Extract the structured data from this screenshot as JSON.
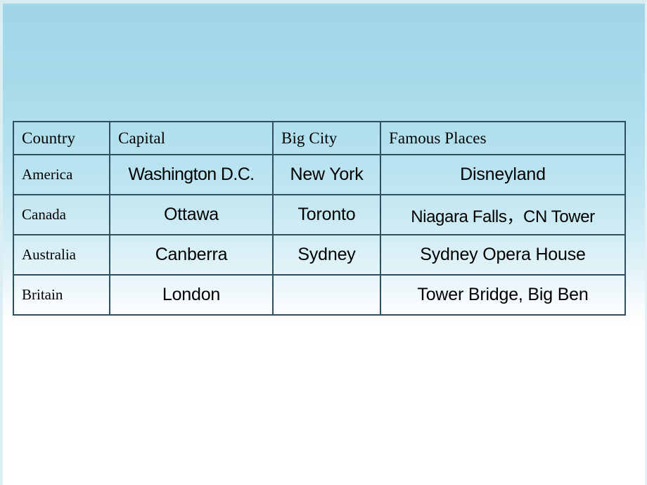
{
  "slide": {
    "background_top_color": "#a4d9e8",
    "background_bottom_color": "#ffffff",
    "table_border_color": "#2d4f5e",
    "text_color": "#000000"
  },
  "table": {
    "headers": [
      "Country",
      "Capital",
      "Big City",
      "Famous Places"
    ],
    "rows": [
      {
        "country": "America",
        "capital": "Washington D.C.",
        "big_city": "New York",
        "famous_places": "Disneyland"
      },
      {
        "country": "Canada",
        "capital": "Ottawa",
        "big_city": "Toronto",
        "famous_places": "Niagara Falls，CN Tower"
      },
      {
        "country": "Australia",
        "capital": "Canberra",
        "big_city": "Sydney",
        "famous_places": "Sydney Opera House"
      },
      {
        "country": "Britain",
        "capital": "London",
        "big_city": "",
        "famous_places": "Tower Bridge, Big Ben"
      }
    ]
  }
}
